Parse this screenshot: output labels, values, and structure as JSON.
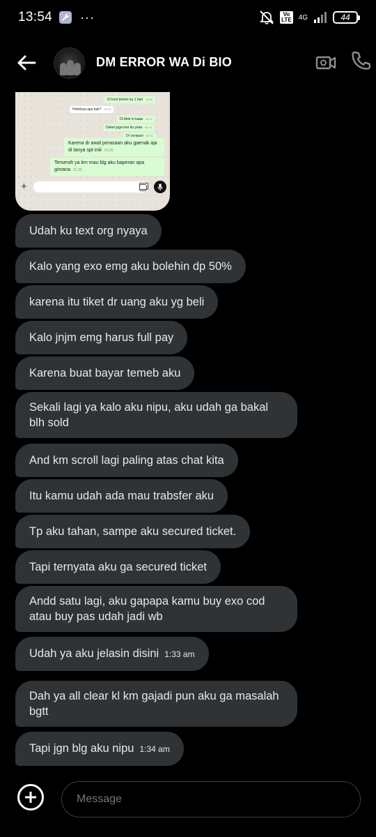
{
  "status_bar": {
    "time": "13:54",
    "overflow": "···",
    "volte": "Vo\nLTE",
    "network": "4G",
    "battery": "44"
  },
  "header": {
    "title": "DM ERROR WA Di BIO"
  },
  "shared_screenshot": {
    "messages": [
      {
        "text": "Di kost temen ku 1 hari",
        "time": "11.59",
        "dir": "out"
      },
      {
        "text": "Hotelnya apa kak?",
        "time": "00.00",
        "dir": "in"
      },
      {
        "text": "Di blok m kaaa",
        "time": "00.01",
        "dir": "out"
      },
      {
        "text": "Deket juga kan itu yaaa",
        "time": "00.01",
        "dir": "out"
      },
      {
        "text": "Dr cerapan",
        "time": "00.01",
        "dir": "out"
      },
      {
        "text": "Karena dr awal perasaan aku gaenak aja  di tanya spt iniii",
        "time": "01.30",
        "dir": "out"
      },
      {
        "text": "Terserah ya km mau blg aku baperan apa gimana",
        "time": "01.30",
        "dir": "out"
      }
    ]
  },
  "messages": [
    {
      "text": "Udah ku text org nyaya"
    },
    {
      "text": "Kalo yang exo emg aku bolehin dp 50%"
    },
    {
      "text": "karena itu tiket dr uang aku yg beli"
    },
    {
      "text": "Kalo jnjm emg harus full pay"
    },
    {
      "text": "Karena buat bayar temeb aku"
    },
    {
      "text": "Sekali lagi ya kalo aku nipu, aku udah ga bakal blh sold"
    },
    {
      "text": "And km scroll lagi paling atas chat kita"
    },
    {
      "text": "Itu kamu udah ada mau trabsfer aku"
    },
    {
      "text": "Tp aku tahan, sampe aku secured ticket."
    },
    {
      "text": "Tapi ternyata aku ga secured ticket"
    },
    {
      "text": "Andd satu lagi, aku gapapa kamu buy exo cod atau buy pas udah jadi wb"
    },
    {
      "text": "Udah ya aku jelasin disini",
      "time": "1:33 am"
    },
    {
      "text": "Dah ya all clear kl km gajadi pun aku ga masalah bgtt"
    },
    {
      "text": "Tapi jgn blg aku nipu",
      "time": "1:34 am"
    }
  ],
  "composer": {
    "placeholder": "Message"
  },
  "icons": {
    "back": "arrow-left-icon",
    "video": "video-call-icon",
    "call": "phone-icon",
    "plus": "plus-circle-icon"
  }
}
